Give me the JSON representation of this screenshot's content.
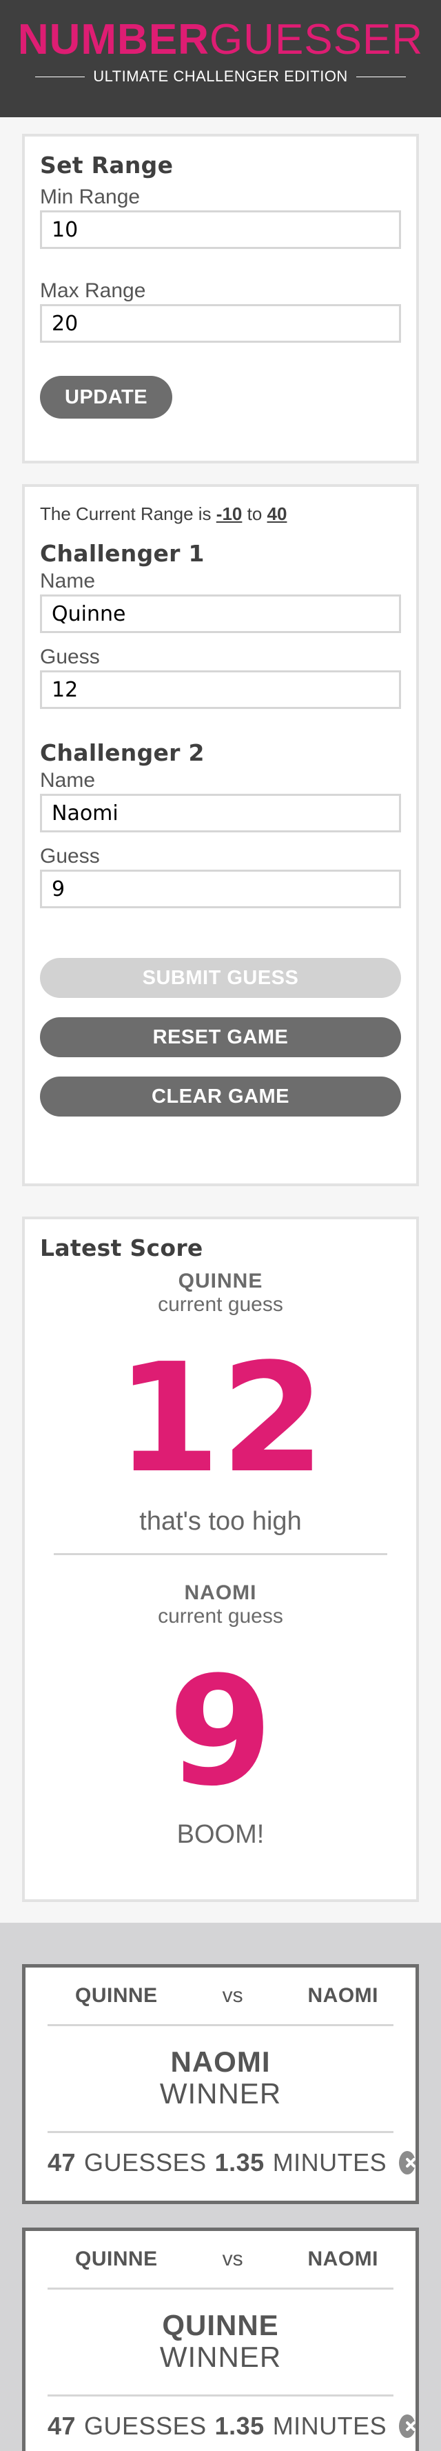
{
  "header": {
    "logo_bold": "NUMBER",
    "logo_light": "GUESSER",
    "subtitle": "ULTIMATE CHALLENGER EDITION"
  },
  "set_range": {
    "title": "Set Range",
    "min_label": "Min Range",
    "min_value": "10",
    "max_label": "Max Range",
    "max_value": "20",
    "update_button": "UPDATE"
  },
  "game": {
    "range_prefix": "The Current Range is ",
    "range_min": "-10",
    "range_mid": " to ",
    "range_max": "40",
    "challenger1": {
      "title": "Challenger 1",
      "name_label": "Name",
      "name_value": "Quinne",
      "guess_label": "Guess",
      "guess_value": "12"
    },
    "challenger2": {
      "title": "Challenger 2",
      "name_label": "Name",
      "name_value": "Naomi",
      "guess_label": "Guess",
      "guess_value": "9"
    },
    "submit_button": "SUBMIT GUESS",
    "reset_button": "RESET GAME",
    "clear_button": "CLEAR GAME"
  },
  "latest_score": {
    "title": "Latest Score",
    "player1": {
      "name": "QUINNE",
      "sub": "current guess",
      "guess": "12",
      "message": "that's too high"
    },
    "player2": {
      "name": "NAOMI",
      "sub": "current guess",
      "guess": "9",
      "message": "BOOM!"
    }
  },
  "results": [
    {
      "player1": "QUINNE",
      "vs": "vs",
      "player2": "NAOMI",
      "winner_name": "NAOMI",
      "winner_label": "WINNER",
      "guesses_count": "47",
      "guesses_label": "GUESSES",
      "minutes_count": "1.35",
      "minutes_label": "MINUTES"
    },
    {
      "player1": "QUINNE",
      "vs": "vs",
      "player2": "NAOMI",
      "winner_name": "QUINNE",
      "winner_label": "WINNER",
      "guesses_count": "47",
      "guesses_label": "GUESSES",
      "minutes_count": "1.35",
      "minutes_label": "MINUTES"
    }
  ],
  "colors": {
    "accent": "#de1d73",
    "header_bg": "#3f3f3f",
    "button_dark": "#6d6d6d",
    "button_disabled": "#d2d2d2"
  }
}
